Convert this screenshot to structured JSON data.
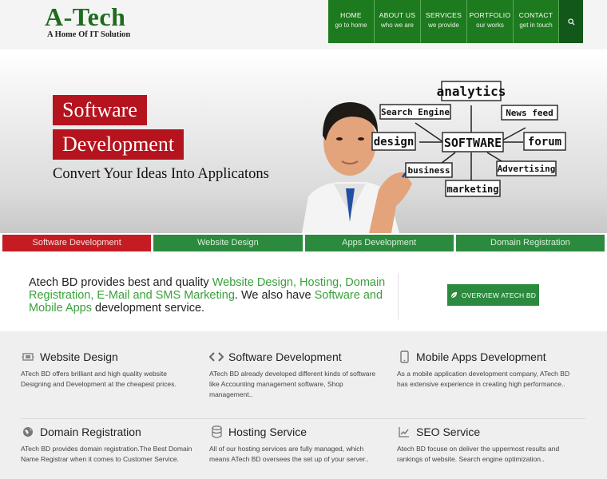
{
  "header": {
    "logo_title": "A-Tech",
    "logo_tagline": "A Home Of IT Solution",
    "nav": [
      {
        "label": "HOME",
        "sub": "go to home"
      },
      {
        "label": "ABOUT US",
        "sub": "who we are"
      },
      {
        "label": "SERVICES",
        "sub": "we provide"
      },
      {
        "label": "PORTFOLIO",
        "sub": "our works"
      },
      {
        "label": "CONTACT",
        "sub": "get in touch"
      }
    ],
    "search_icon": "search-icon"
  },
  "hero": {
    "tag1": "Software",
    "tag2": "Development",
    "subtitle": "Convert Your Ideas Into Applicatons",
    "diagram": {
      "center": "SOFTWARE",
      "words": [
        "analytics",
        "Search Engine",
        "News feed",
        "design",
        "forum",
        "business",
        "Advertising",
        "marketing"
      ]
    }
  },
  "categories": [
    {
      "label": "Software Development",
      "active": true
    },
    {
      "label": "Website Design",
      "active": false
    },
    {
      "label": "Apps Development",
      "active": false
    },
    {
      "label": "Domain Registration",
      "active": false
    }
  ],
  "intro": {
    "p1": "Atech BD provides best and quality ",
    "h1": "Website Design, Hosting, Domain Registration, E-Mail and SMS Marketing",
    "p2": ". We also have ",
    "h2": "Software and Mobile Apps",
    "p3": " development service.",
    "button": "OVERVIEW ATECH BD"
  },
  "services": [
    {
      "icon": "monitor-icon",
      "title": "Website Design",
      "text": "ATech BD offers brilliant and high quality website Designing and Development at the cheapest prices."
    },
    {
      "icon": "code-icon",
      "title": "Software Development",
      "text": "ATech BD already developed different kinds of software like Accounting management software, Shop management.."
    },
    {
      "icon": "mobile-icon",
      "title": "Mobile Apps Development",
      "text": "As a mobile application development company, ATech BD has extensive experience in creating high performance.."
    },
    {
      "icon": "globe-icon",
      "title": "Domain Registration",
      "text": "ATech BD provides domain registration.The Best Domain Name Registrar when it comes to Customer Service."
    },
    {
      "icon": "database-icon",
      "title": "Hosting Service",
      "text": "All of our hosting services are fully managed, which means ATech BD oversees the set up of your server.."
    },
    {
      "icon": "chart-icon",
      "title": "SEO Service",
      "text": "Atech BD focuse on deliver the uppermost results and rankings of website. Search engine optimization.."
    }
  ],
  "colors": {
    "brand_green": "#1e7a1e",
    "accent_red": "#b5141e",
    "highlight_green": "#3aa13a"
  }
}
